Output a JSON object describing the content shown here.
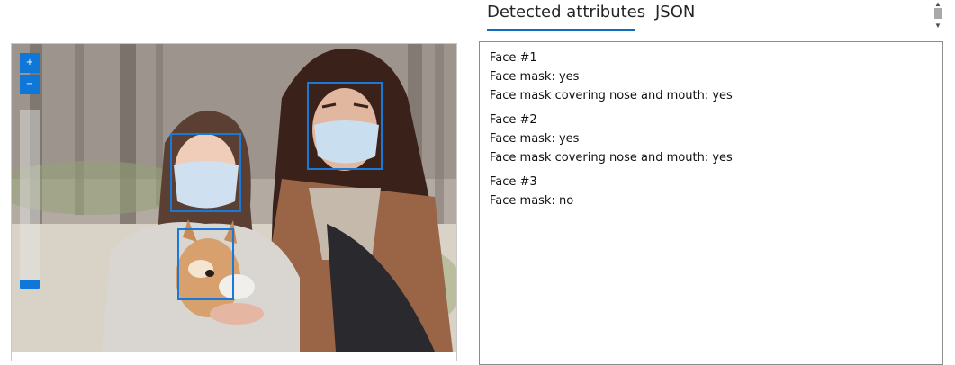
{
  "tabs": {
    "detected_attributes": "Detected attributes",
    "json": "JSON",
    "active": "detected_attributes"
  },
  "image_viewer": {
    "zoom_in_label": "+",
    "zoom_out_label": "−",
    "face_box_color": "#1a78d6"
  },
  "results": [
    {
      "face": "Face #1",
      "mask": "Face mask: yes",
      "covering": "Face mask covering nose and mouth: yes"
    },
    {
      "face": "Face #2",
      "mask": "Face mask: yes",
      "covering": "Face mask covering nose and mouth: yes"
    },
    {
      "face": "Face #3",
      "mask": "Face mask: no"
    }
  ],
  "scrollbar": {
    "up_icon": "triangle-up-icon",
    "down_icon": "triangle-down-icon"
  },
  "colors": {
    "accent": "#0f6cbd",
    "zoom_button": "#0f77d8"
  }
}
